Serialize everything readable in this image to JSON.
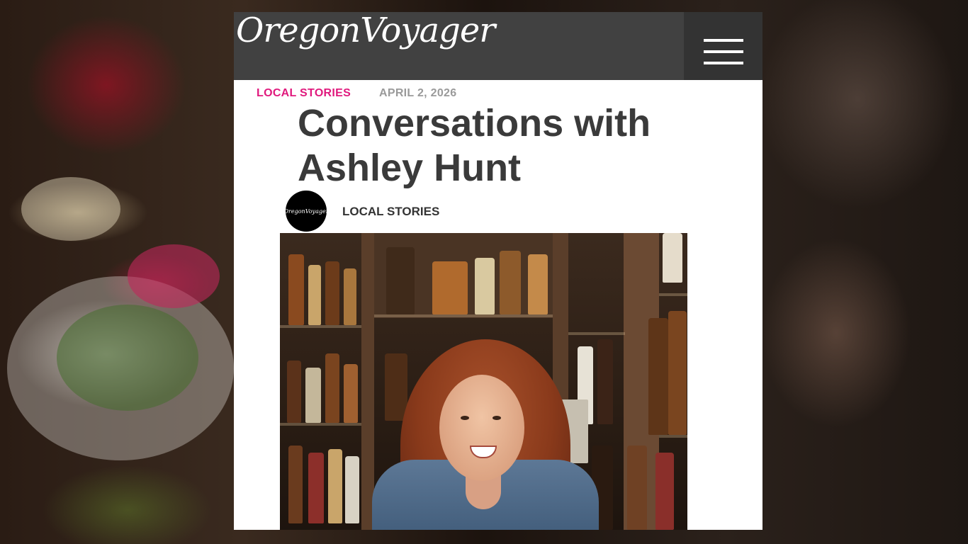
{
  "site": {
    "logo": "OregonVoyager",
    "menu_icon": "hamburger-menu-icon"
  },
  "article": {
    "category": "LOCAL STORIES",
    "date": "APRIL 2, 2026",
    "title": "Conversations with Ashley Hunt",
    "author_avatar_text": "OregonVoyager",
    "author_category": "LOCAL STORIES",
    "hero_image_description": "hero-photo"
  },
  "colors": {
    "accent": "#e0197d",
    "header_bg": "#414141",
    "menu_bg": "#333333",
    "date_gray": "#9a9a9a",
    "title_text": "#3a3a3a"
  }
}
